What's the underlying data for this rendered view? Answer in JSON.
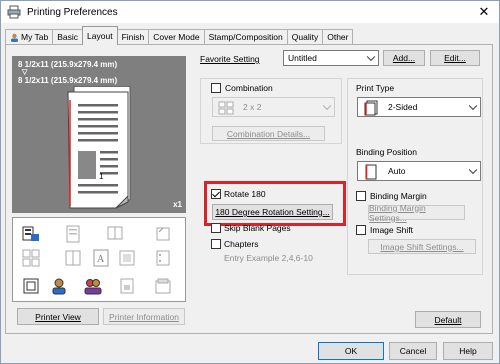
{
  "window": {
    "title": "Printing Preferences",
    "close_symbol": "✕"
  },
  "tabs": [
    "My Tab",
    "Basic",
    "Layout",
    "Finish",
    "Cover Mode",
    "Stamp/Composition",
    "Quality",
    "Other"
  ],
  "active_tab": "Layout",
  "preview": {
    "paper_size_1": "8 1/2x11 (215.9x279.4 mm)",
    "arrow": "▽",
    "paper_size_2": "8 1/2x11 (215.9x279.4 mm)",
    "copies": "x1",
    "page_number": "1"
  },
  "favorite": {
    "label": "Favorite Setting",
    "value": "Untitled",
    "add": "Add...",
    "edit": "Edit..."
  },
  "combination": {
    "label": "Combination",
    "value": "2 x 2",
    "details": "Combination Details..."
  },
  "rotate": {
    "label": "Rotate 180",
    "button": "180 Degree Rotation Setting..."
  },
  "skip_blank": "Skip Blank Pages",
  "chapters": {
    "label": "Chapters",
    "placeholder": "Entry Example 2,4,6-10"
  },
  "print_type": {
    "label": "Print Type",
    "value": "2-Sided"
  },
  "binding_position": {
    "label": "Binding Position",
    "value": "Auto"
  },
  "binding_margin": {
    "label": "Binding Margin",
    "button": "Binding Margin Settings..."
  },
  "image_shift": {
    "label": "Image Shift",
    "button": "Image Shift Settings..."
  },
  "printer_view": "Printer View",
  "printer_info": "Printer Information",
  "default_btn": "Default",
  "ok": "OK",
  "cancel": "Cancel",
  "help": "Help"
}
